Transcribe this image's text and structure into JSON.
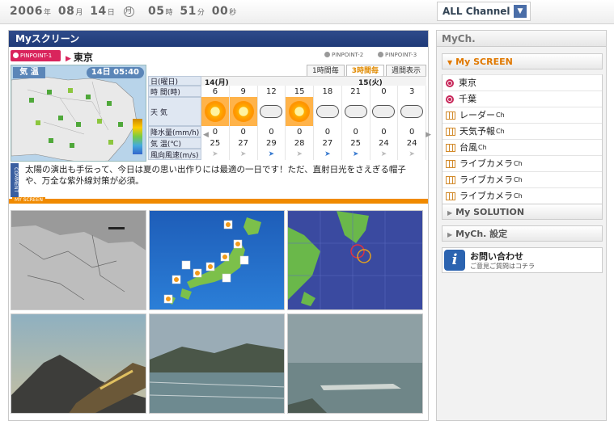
{
  "datetime": {
    "year": "2006",
    "year_u": "年",
    "month": "08",
    "month_u": "月",
    "day": "14",
    "day_u": "日",
    "dow": "月",
    "hour": "05",
    "hour_u": "時",
    "min": "51",
    "min_u": "分",
    "sec": "00",
    "sec_u": "秒"
  },
  "all_channel": {
    "label": "ALL Channel",
    "icon": "dropdown-arrow-icon"
  },
  "main": {
    "title": "Myスクリーン",
    "pinpoint1": "PINPOINT-1",
    "pinpoint2": "PINPOINT-2",
    "pinpoint3": "PINPOINT-3",
    "location": "東京",
    "map_label": "気 温",
    "map_time": "14日 05:40",
    "forecast_tabs": [
      "1時間毎",
      "3時間毎",
      "週間表示"
    ],
    "active_tab": "3時間毎",
    "row_labels": {
      "date": "日(曜日)",
      "hour": "時 間(時)",
      "weather": "天 気",
      "rain": "降水量(mm/h)",
      "temp": "気 温(℃)",
      "wind": "風向風速(m/s)"
    },
    "date1": "14(月)",
    "date2": "15(火)",
    "hours": [
      "6",
      "9",
      "12",
      "15",
      "18",
      "21",
      "0",
      "3"
    ],
    "weather": [
      "sunny",
      "sunny",
      "cloudy",
      "sunny",
      "cloudy",
      "cloudy",
      "cloudy",
      "cloudy"
    ],
    "rain": [
      "0",
      "0",
      "0",
      "0",
      "0",
      "0",
      "0",
      "0"
    ],
    "temp": [
      "25",
      "27",
      "29",
      "28",
      "27",
      "25",
      "24",
      "24"
    ],
    "wind": [
      "light",
      "light",
      "strong",
      "light",
      "strong",
      "strong",
      "light",
      "light"
    ],
    "comment_tag": "COMMENT",
    "comment": "太陽の演出も手伝って、今日は夏の思い出作りには最適の一日です！ただ、直射日光をさえぎる帽子や、万全な紫外線対策が必須。",
    "myscreen_label": "MY SCREEN"
  },
  "side": {
    "title": "MyCh.",
    "screen_head": "My SCREEN",
    "items": [
      {
        "label": "東京",
        "ch": "",
        "type": "radio"
      },
      {
        "label": "千葉",
        "ch": "",
        "type": "radio"
      },
      {
        "label": "レーダー",
        "ch": "Ch",
        "type": "grid"
      },
      {
        "label": "天気予報",
        "ch": "Ch",
        "type": "grid"
      },
      {
        "label": "台風",
        "ch": "Ch",
        "type": "grid"
      },
      {
        "label": "ライブカメラ",
        "ch": "Ch",
        "type": "grid"
      },
      {
        "label": "ライブカメラ",
        "ch": "Ch",
        "type": "grid"
      },
      {
        "label": "ライブカメラ",
        "ch": "Ch",
        "type": "grid"
      }
    ],
    "solution_head": "My SOLUTION",
    "settings_head": "MyCh. 設定",
    "contact_title": "お問い合わせ",
    "contact_sub": "ご意見ご質問はコチラ"
  },
  "colors": {
    "header_blue": "#1f3a78",
    "accent_orange": "#f08a00",
    "pink": "#d9245c"
  }
}
